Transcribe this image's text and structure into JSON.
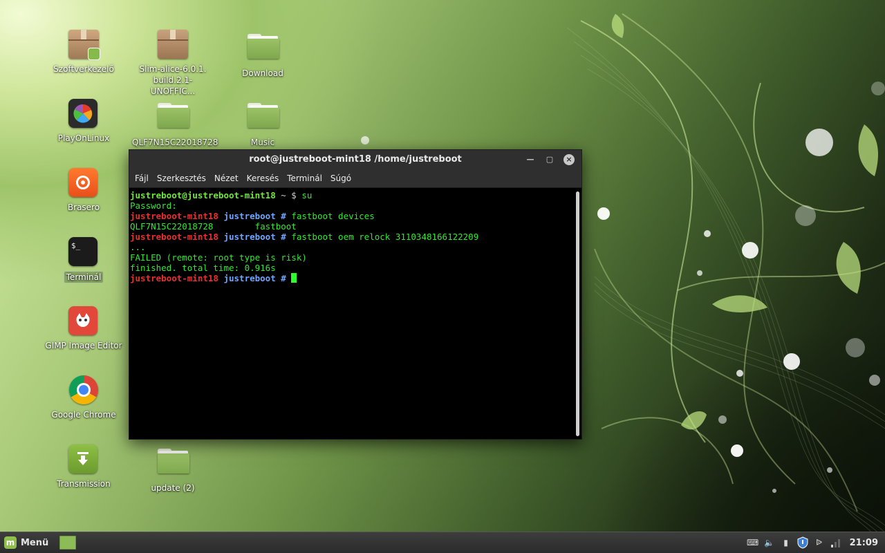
{
  "desktop": {
    "icons": [
      {
        "label": "Szoftverkezelő"
      },
      {
        "label": "Slim-alice-6.0.1.\nbuild.2.1-UNOFFIC..."
      },
      {
        "label": "Download"
      },
      {
        "label": "PlayOnLinux"
      },
      {
        "label": "QLF7N15C22018728"
      },
      {
        "label": "Music"
      },
      {
        "label": "Brasero"
      },
      {
        "label": "Terminál"
      },
      {
        "label": "GIMP Image Editor"
      },
      {
        "label": "Google Chrome"
      },
      {
        "label": "Transmission"
      },
      {
        "label": "update (2)"
      }
    ]
  },
  "terminal": {
    "title": "root@justreboot-mint18 /home/justreboot",
    "menu": [
      "Fájl",
      "Szerkesztés",
      "Nézet",
      "Keresés",
      "Terminál",
      "Súgó"
    ],
    "lines": {
      "l1_user": "justreboot@justreboot-mint18",
      "l1_prompt": " ~ $ ",
      "l1_cmd": "su",
      "l2": "Password:",
      "host": "justreboot-mint18",
      "dir": "justreboot",
      "hash": " # ",
      "l3_cmd": "fastboot devices",
      "l4": "QLF7N15C22018728        fastboot",
      "l5_cmd": "fastboot oem relock 3110348166122209",
      "l6": "...",
      "l7": "FAILED (remote: root type is risk)",
      "l8": "finished. total time: 0.916s"
    }
  },
  "panel": {
    "menu_label": "Menü",
    "clock": "21:09"
  }
}
